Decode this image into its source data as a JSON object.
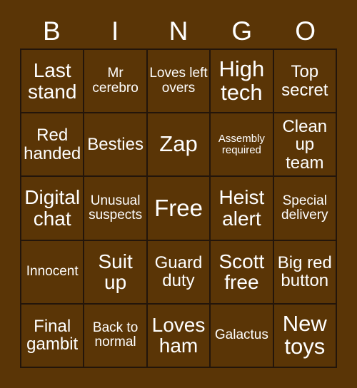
{
  "card": {
    "title": "BINGO",
    "background_color": "#5a3506",
    "text_color": "#ffffff",
    "border_color": "#23150a"
  },
  "header": {
    "letters": [
      "B",
      "I",
      "N",
      "G",
      "O"
    ]
  },
  "grid": {
    "columns": 5,
    "rows": 5,
    "cells": [
      {
        "text": "Last stand",
        "size": "lg"
      },
      {
        "text": "Mr cerebro",
        "size": "sm"
      },
      {
        "text": "Loves left overs",
        "size": "sm"
      },
      {
        "text": "High tech",
        "size": "xl"
      },
      {
        "text": "Top secret",
        "size": "md"
      },
      {
        "text": "Red handed",
        "size": "md"
      },
      {
        "text": "Besties",
        "size": "md"
      },
      {
        "text": "Zap",
        "size": "xl"
      },
      {
        "text": "Assembly required",
        "size": "xs"
      },
      {
        "text": "Clean up team",
        "size": "md"
      },
      {
        "text": "Digital chat",
        "size": "lg"
      },
      {
        "text": "Unusual suspects",
        "size": "sm"
      },
      {
        "text": "Free",
        "size": "free"
      },
      {
        "text": "Heist alert",
        "size": "lg"
      },
      {
        "text": "Special delivery",
        "size": "sm"
      },
      {
        "text": "Innocent",
        "size": "sm"
      },
      {
        "text": "Suit up",
        "size": "lg"
      },
      {
        "text": "Guard duty",
        "size": "md"
      },
      {
        "text": "Scott free",
        "size": "lg"
      },
      {
        "text": "Big red button",
        "size": "md"
      },
      {
        "text": "Final gambit",
        "size": "md"
      },
      {
        "text": "Back to normal",
        "size": "sm"
      },
      {
        "text": "Loves ham",
        "size": "lg"
      },
      {
        "text": "Galactus",
        "size": "sm"
      },
      {
        "text": "New toys",
        "size": "xl"
      }
    ]
  }
}
